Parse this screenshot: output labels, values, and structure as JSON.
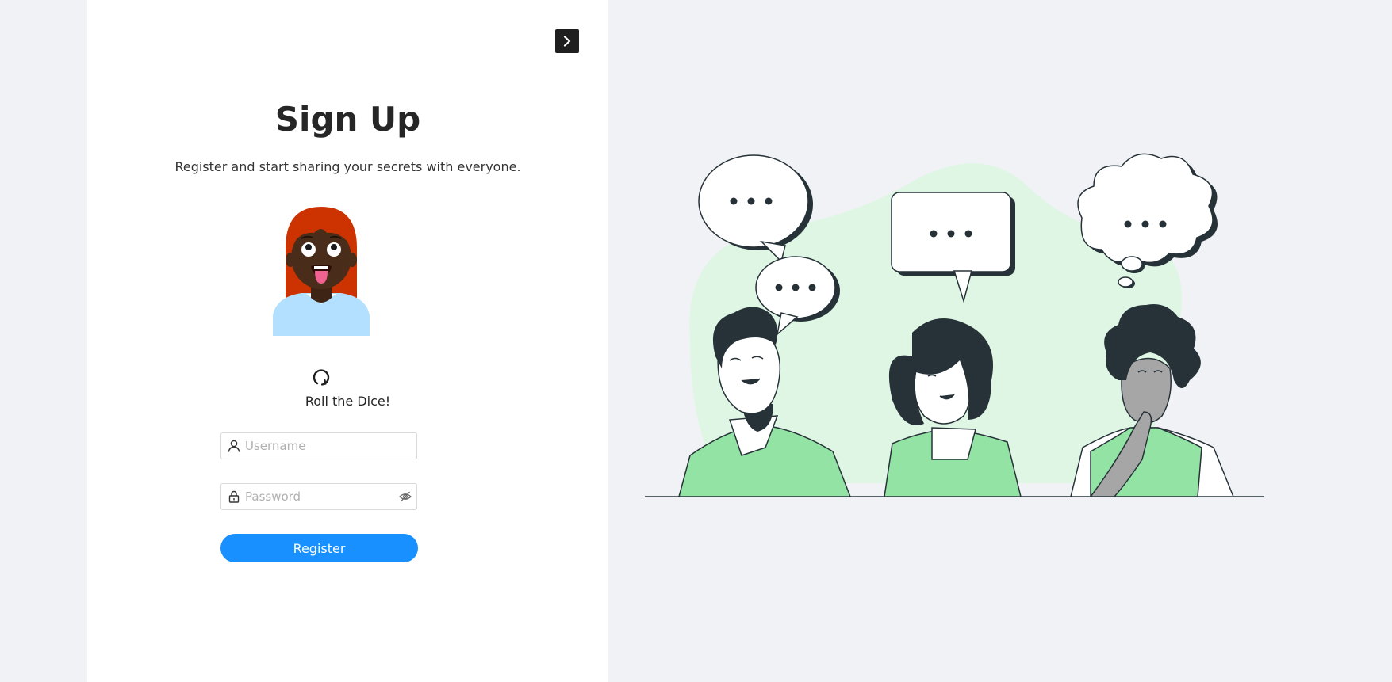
{
  "header": {
    "title": "Sign Up",
    "subtitle": "Register and start sharing your secrets with everyone."
  },
  "dice": {
    "label": "Roll the Dice!"
  },
  "form": {
    "username_placeholder": "Username",
    "password_placeholder": "Password",
    "register_label": "Register"
  },
  "colors": {
    "primary": "#1890ff",
    "panel_bg": "#ffffff",
    "page_bg": "#f0f2f5",
    "shirt_green": "#93e3a4",
    "blob_green": "#dff6e5",
    "ink": "#263238"
  },
  "icons": {
    "toggle": "chevron-right-icon",
    "dice": "reload-icon",
    "username": "user-icon",
    "password": "lock-icon",
    "password_visibility": "eye-invisible-icon"
  }
}
